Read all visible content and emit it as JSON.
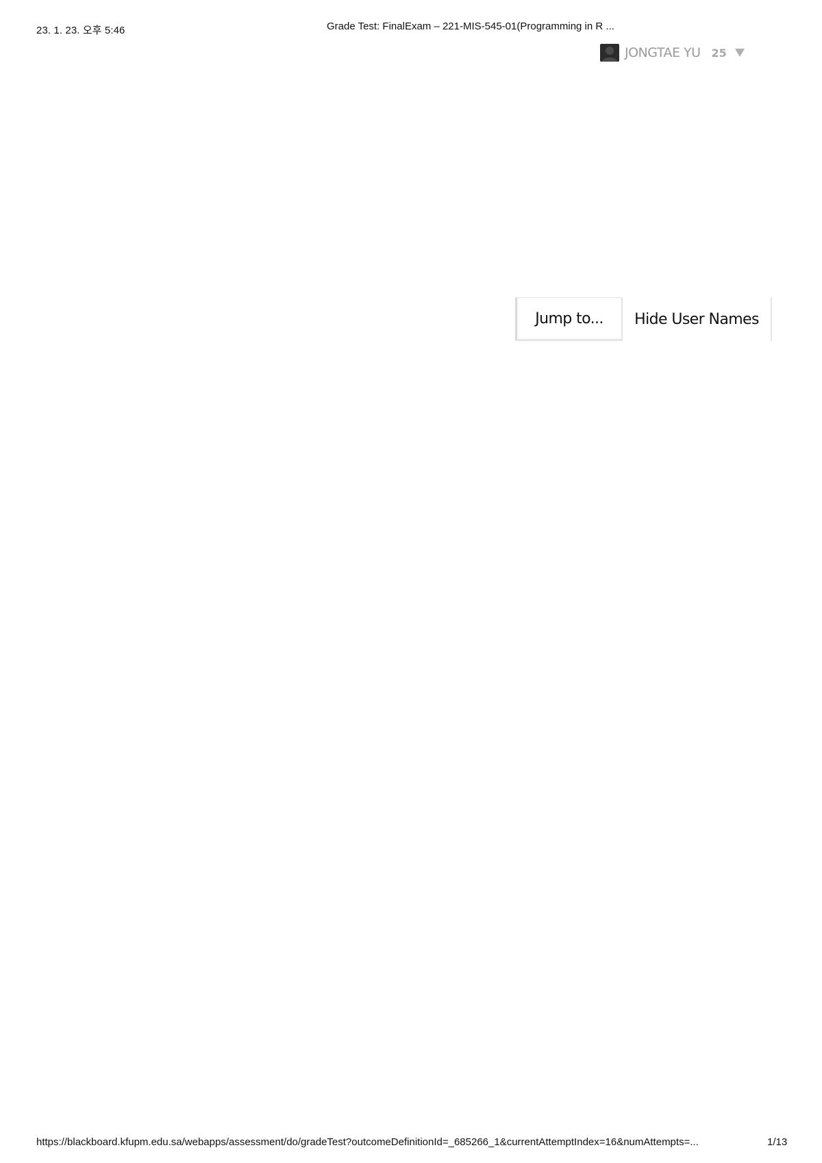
{
  "print_header": {
    "datetime": "23. 1. 23. 오후 5:46",
    "page_title": "Grade Test: FinalExam – 221-MIS-545-01(Programming in R ..."
  },
  "user": {
    "avatar_icon": "user-avatar-icon",
    "name": "JONGTAE YU",
    "count": "25",
    "caret_icon": "caret-down-icon"
  },
  "actions": {
    "jump_label": "Jump to...",
    "hide_names_label": "Hide User Names"
  },
  "print_footer": {
    "url": "https://blackboard.kfupm.edu.sa/webapps/assessment/do/gradeTest?outcomeDefinitionId=_685266_1&currentAttemptIndex=16&numAttempts=...",
    "page_number": "1/13"
  },
  "colors": {
    "muted_text": "#9a9a9a",
    "caret": "#b0b0b0",
    "avatar_bg": "#2b2b2b"
  }
}
